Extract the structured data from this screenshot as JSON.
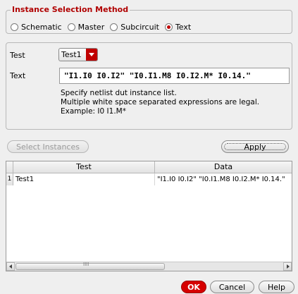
{
  "method_group": {
    "title": "Instance Selection Method",
    "options": [
      {
        "label": "Schematic",
        "selected": false
      },
      {
        "label": "Master",
        "selected": false
      },
      {
        "label": "Subcircuit",
        "selected": false
      },
      {
        "label": "Text",
        "selected": true
      }
    ]
  },
  "test_field": {
    "label": "Test",
    "value": "Test1"
  },
  "text_field": {
    "label": "Text",
    "value": "\"I1.I0 I0.I2\" \"I0.I1.M8 I0.I2.M* I0.14.\""
  },
  "help_lines": [
    "Specify netlist dut instance list.",
    "Multiple white space separated expressions are legal.",
    "Example: I0 I1.M*"
  ],
  "buttons": {
    "select_instances": "Select Instances",
    "apply": "Apply",
    "ok": "OK",
    "cancel": "Cancel",
    "help": "Help"
  },
  "table": {
    "columns": [
      "Test",
      "Data"
    ],
    "rows": [
      {
        "num": "1",
        "test": "Test1",
        "data": "\"I1.I0 I0.I2\" \"I0.I1.M8 I0.I2.M* I0.14.\""
      }
    ],
    "scroll_grip": "IIII"
  },
  "colors": {
    "accent": "#c00000",
    "background": "#efefef"
  }
}
